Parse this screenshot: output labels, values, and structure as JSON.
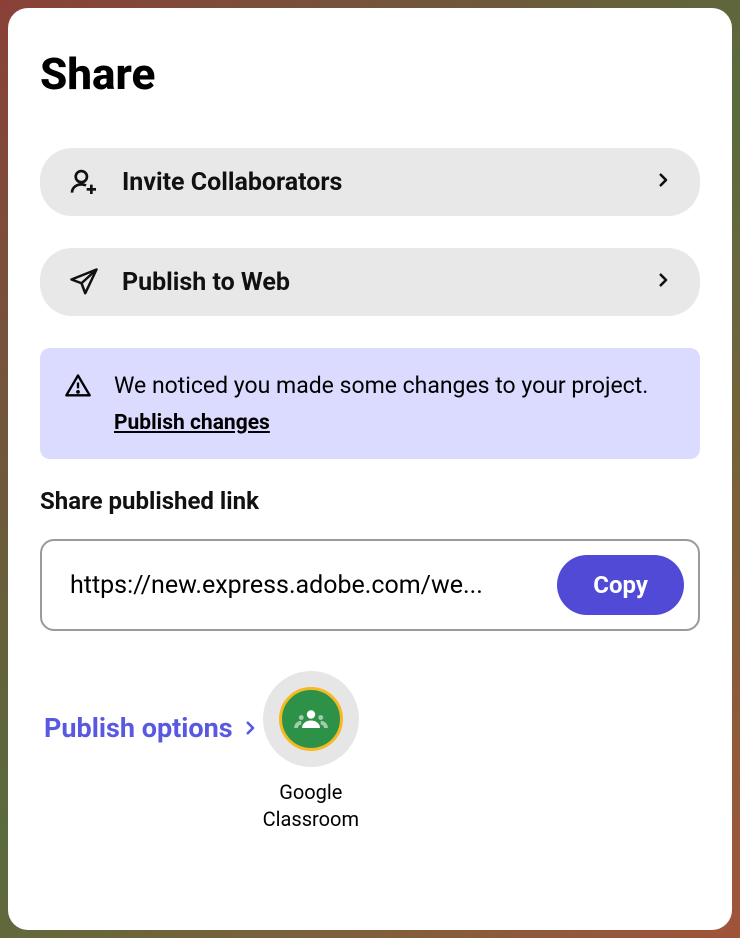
{
  "title": "Share",
  "options": {
    "invite": "Invite Collaborators",
    "publish": "Publish to Web"
  },
  "notice": {
    "text": "We noticed you made some changes to your project. ",
    "link": "Publish changes"
  },
  "share_link": {
    "section_label": "Share published link",
    "url": "https://new.express.adobe.com/we...",
    "copy_label": "Copy"
  },
  "publish_options_label": "Publish options",
  "targets": {
    "google_classroom": "Google\nClassroom"
  }
}
